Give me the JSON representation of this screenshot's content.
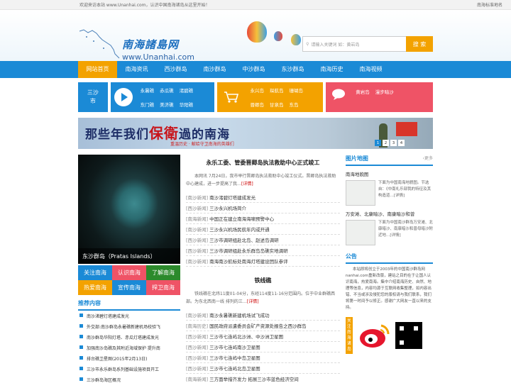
{
  "top": {
    "welcome": "欢迎来访本站 www.Unanhai.com，认识中国南海诸岛从这里开始！",
    "right": "南海标准地名"
  },
  "logo": {
    "cn": "南海諸島网",
    "url": "www.Unanhai.com"
  },
  "search": {
    "placeholder": "请输入关键词 如：黄岩岛",
    "button": "搜 索"
  },
  "nav": [
    "网站首页",
    "南海资讯",
    "西沙群岛",
    "南沙群岛",
    "中沙群岛",
    "东沙群岛",
    "南海历史",
    "南海视频"
  ],
  "cats": {
    "sansha": "三沙市",
    "video_links": [
      "永暑礁",
      "赤瓜礁",
      "渚碧礁",
      "东门礁",
      "美济礁",
      "华阳礁"
    ],
    "shop_links": [
      "永兴岛",
      "琛航岛",
      "珊瑚岛",
      "晋卿岛",
      "甘泉岛",
      "东岛"
    ],
    "chat_links": [
      "黄岩岛",
      "漫步暗沙"
    ]
  },
  "banner": {
    "text_pre": "那些年我们",
    "text_big": "保衛",
    "text_post": "過的南海",
    "sub": "重温历史 · 献给守卫南海的英雄们",
    "pages": [
      "1",
      "2",
      "3",
      "4"
    ]
  },
  "photo_caption": "东沙群岛（Pratas Islands）",
  "quick": [
    "关注南海",
    "认识南海",
    "了解南海",
    "热爱南海",
    "宣传南海",
    "捍卫南海"
  ],
  "recommend": {
    "title": "推荐内容",
    "items": [
      "南沙渚碧灯塔建成发光",
      "外交部:南沙群岛永暑礁新建机场校验飞",
      "南沙群岛华阳灯塔、赤瓜灯塔建成发光",
      "加强南沙岛礁及其附近海域保护 提升南",
      "排台礁卫星图(2015年2月13日)",
      "三沙市永乐群岛系列基础设施项目开工",
      "三沙群岛海区概况"
    ]
  },
  "article1": {
    "title": "永乐工委、管委晋卿岛执法救助中心正式竣工",
    "body": "本网讯 7月24日，我市举行晋卿岛执法救助中心竣工仪式。晋卿岛执法救助中心建成，进一步提高了我…",
    "more": "[详情]"
  },
  "news1": [
    {
      "c": "[南沙新闻]",
      "t": "南沙渚碧灯塔建成发光"
    },
    {
      "c": "[西沙新闻]",
      "t": "三沙永兴机场简介"
    },
    {
      "c": "[南海新闻]",
      "t": "中国正在建立南海海啸预警中心"
    },
    {
      "c": "[南沙新闻]",
      "t": "三沙永兴机场民航年内或开通"
    },
    {
      "c": "[西沙新闻]",
      "t": "三沙市调研组赴北岛、赵述岛调研"
    },
    {
      "c": "[西沙新闻]",
      "t": "三沙市调研组赴永乐群岛岛礁实地调研"
    },
    {
      "c": "[南沙新闻]",
      "t": "南海南沙航标处南海灯塔建设团队参评"
    }
  ],
  "article2": {
    "title": "铁线礁",
    "body": "铁线礁在北纬11度01-04分，东经114度11-16分范围内。位于中业群礁西部。为东北西南一线 排列的三…",
    "more": "[详情]"
  },
  "news2": [
    {
      "c": "[南沙新闻]",
      "t": "南沙永暑礁新建机场试飞成功"
    },
    {
      "c": "[南海历史]",
      "t": "国民政府派遣委员会矿产资源处报告之西沙群岛"
    },
    {
      "c": "[西沙新闻]",
      "t": "三沙市七连屿北沙洲、中沙洲卫星图"
    },
    {
      "c": "[西沙新闻]",
      "t": "三沙市七连屿南沙卫星图"
    },
    {
      "c": "[西沙新闻]",
      "t": "三沙市七连屿中岛卫星图"
    },
    {
      "c": "[西沙新闻]",
      "t": "三沙市七连屿北岛卫星图"
    },
    {
      "c": "[南海新闻]",
      "t": "三方面举措齐发力 拓展三沙市蓝色经济空间"
    }
  ],
  "right": {
    "map_title": "图片地图",
    "more": "更多",
    "maps": [
      {
        "t": "南海地貌图",
        "d": "下面为中国南海地貌图。节选自：《中南礼乐部我的特征及其构造道…[详情]"
      },
      {
        "t": "万安滩、北康暗沙、南康暗沙和曾",
        "d": "下面为中国南沙群岛万安滩、北康暗沙、南康暗沙和曾母暗沙附近地…[详情]"
      }
    ],
    "notice_title": "公告",
    "notice": "本站即将创立于2003年的中国南沙群岛网 nanhai.com重新改版，建站之目的在于让国人认识南海，热爱南海。集中介绍南海历史、自然、地理等信息，内容均源于互联网收集整理，如内容出错、不当或涉及侵犯您的版权请与我们联系，我们将第一时间予以修正。感谢广大网友一直以来的支持。",
    "weibo_label": "关注南海诸岛"
  },
  "colors": {
    "blue": "#1b8ad6",
    "orange": "#f3a200",
    "red": "#ef5366",
    "dark_red": "#c0392b",
    "green": "#2c8a2c"
  }
}
